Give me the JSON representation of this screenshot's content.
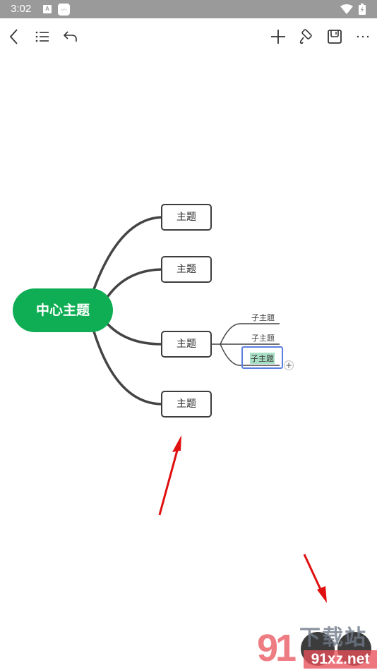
{
  "status_bar": {
    "time": "3:02",
    "notification_icons": [
      "a-icon",
      "wps-icon"
    ],
    "wps_label": "WPS",
    "a_label": "A"
  },
  "toolbar": {
    "left": [
      "back-icon",
      "outline-list-icon",
      "undo-icon"
    ],
    "right": [
      "add-icon",
      "format-painter-icon",
      "save-icon",
      "more-icon"
    ]
  },
  "mindmap": {
    "center": "中心主题",
    "topics": [
      {
        "label": "主题",
        "subtopics": []
      },
      {
        "label": "主题",
        "subtopics": []
      },
      {
        "label": "主题",
        "subtopics": [
          "子主题",
          "子主题",
          "子主题"
        ],
        "selected_subtopic_index": 2
      },
      {
        "label": "主题",
        "subtopics": []
      }
    ],
    "add_child_label": "+",
    "colors": {
      "center": "#0fae54",
      "line": "#444444",
      "selection": "#5b7fe0",
      "highlight": "#a8e0c5"
    }
  },
  "annotations": {
    "arrow_color": "#e01010",
    "arrow_count": 2
  },
  "watermark": {
    "logo": "91",
    "text": "下载站",
    "url": "91xz.net"
  }
}
